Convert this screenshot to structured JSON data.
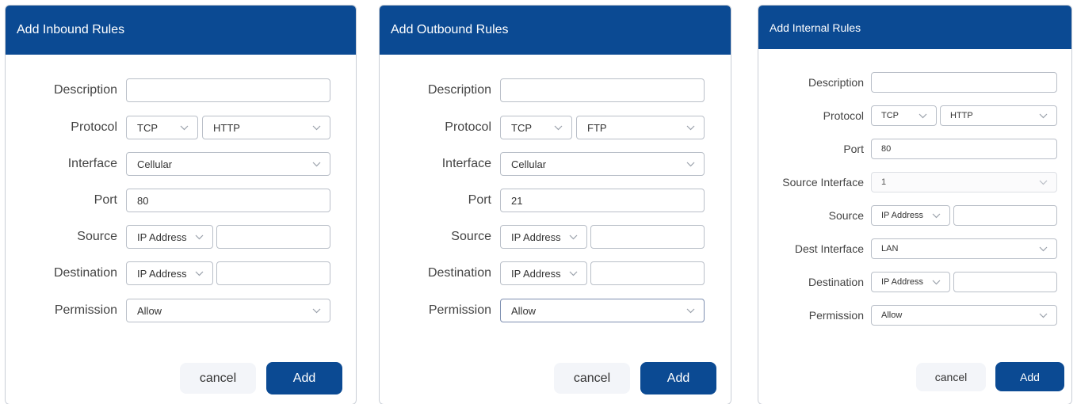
{
  "colors": {
    "header": "#0b4a93",
    "primary_button": "#0b4a93",
    "cancel_button": "#f3f5f9"
  },
  "inbound": {
    "title": "Add Inbound Rules",
    "labels": {
      "description": "Description",
      "protocol": "Protocol",
      "interface": "Interface",
      "port": "Port",
      "source": "Source",
      "destination": "Destination",
      "permission": "Permission"
    },
    "values": {
      "description": "",
      "protocol": "TCP",
      "service": "HTTP",
      "interface": "Cellular",
      "port": "80",
      "source_type": "IP Address",
      "source_value": "",
      "destination_type": "IP Address",
      "destination_value": "",
      "permission": "Allow"
    },
    "buttons": {
      "cancel": "cancel",
      "add": "Add"
    }
  },
  "outbound": {
    "title": "Add Outbound Rules",
    "labels": {
      "description": "Description",
      "protocol": "Protocol",
      "interface": "Interface",
      "port": "Port",
      "source": "Source",
      "destination": "Destination",
      "permission": "Permission"
    },
    "values": {
      "description": "",
      "protocol": "TCP",
      "service": "FTP",
      "interface": "Cellular",
      "port": "21",
      "source_type": "IP Address",
      "source_value": "",
      "destination_type": "IP Address",
      "destination_value": "",
      "permission": "Allow"
    },
    "buttons": {
      "cancel": "cancel",
      "add": "Add"
    }
  },
  "internal": {
    "title": "Add Internal Rules",
    "labels": {
      "description": "Description",
      "protocol": "Protocol",
      "port": "Port",
      "source_interface": "Source Interface",
      "source": "Source",
      "dest_interface": "Dest Interface",
      "destination": "Destination",
      "permission": "Permission"
    },
    "values": {
      "description": "",
      "protocol": "TCP",
      "service": "HTTP",
      "port": "80",
      "source_interface": "1",
      "source_type": "IP Address",
      "source_value": "",
      "dest_interface": "LAN",
      "destination_type": "IP Address",
      "destination_value": "",
      "permission": "Allow"
    },
    "buttons": {
      "cancel": "cancel",
      "add": "Add"
    }
  }
}
